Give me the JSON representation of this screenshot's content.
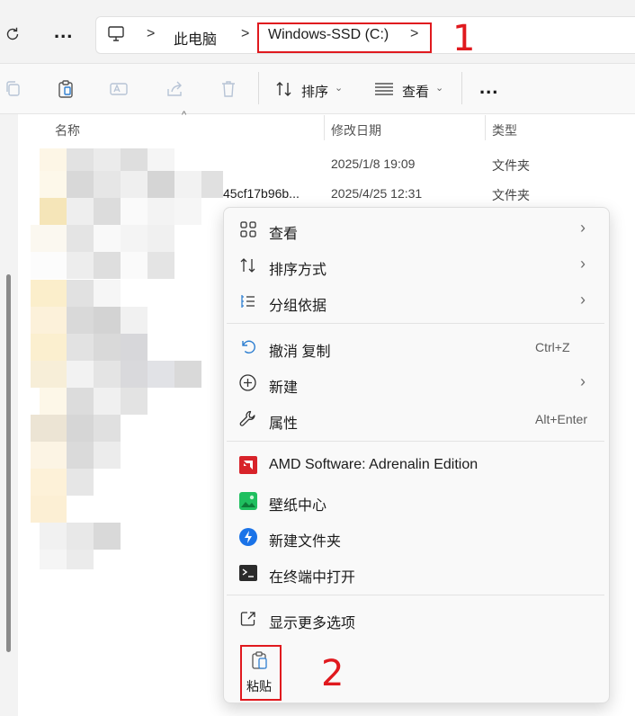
{
  "address_bar": {
    "crumbs": [
      "此电脑",
      "Windows-SSD (C:)"
    ],
    "separator": ">",
    "more_label": "..."
  },
  "annotations": {
    "marker_1": "1",
    "marker_2": "2"
  },
  "toolbar": {
    "sort_label": "排序",
    "view_label": "查看",
    "more_label": "..."
  },
  "file_list": {
    "columns": [
      "名称",
      "修改日期",
      "类型"
    ],
    "rows": [
      {
        "name": "",
        "modified": "2025/1/8 19:09",
        "type": "文件夹"
      },
      {
        "name": "45cf17b96b...",
        "modified": "2025/4/25 12:31",
        "type": "文件夹"
      }
    ]
  },
  "context_menu": {
    "items": [
      {
        "label": "查看",
        "shortcut": "",
        "icon": "grid-icon",
        "submenu": true
      },
      {
        "label": "排序方式",
        "shortcut": "",
        "icon": "sort-icon",
        "submenu": true
      },
      {
        "label": "分组依据",
        "shortcut": "",
        "icon": "group-list-icon",
        "submenu": true
      },
      {
        "label": "撤消 复制",
        "shortcut": "Ctrl+Z",
        "icon": "undo-icon",
        "submenu": false
      },
      {
        "label": "新建",
        "shortcut": "",
        "icon": "add-circle-icon",
        "submenu": true
      },
      {
        "label": "属性",
        "shortcut": "Alt+Enter",
        "icon": "wrench-icon",
        "submenu": false
      },
      {
        "label": "AMD Software: Adrenalin Edition",
        "shortcut": "",
        "icon": "amd-icon",
        "submenu": false
      },
      {
        "label": "壁纸中心",
        "shortcut": "",
        "icon": "wallpaper-icon",
        "submenu": false
      },
      {
        "label": "新建文件夹",
        "shortcut": "",
        "icon": "new-folder-icon",
        "submenu": false
      },
      {
        "label": "在终端中打开",
        "shortcut": "",
        "icon": "terminal-icon",
        "submenu": false
      },
      {
        "label": "显示更多选项",
        "shortcut": "",
        "icon": "open-external-icon",
        "submenu": false
      }
    ],
    "bottom_actions": [
      {
        "label": "粘贴",
        "icon": "paste-icon"
      }
    ]
  },
  "colors": {
    "annotation_red": "#e0191e",
    "amd_red": "#d8232a",
    "wallpaper_green": "#1fbf5f",
    "folder_blue": "#1a73e8"
  }
}
